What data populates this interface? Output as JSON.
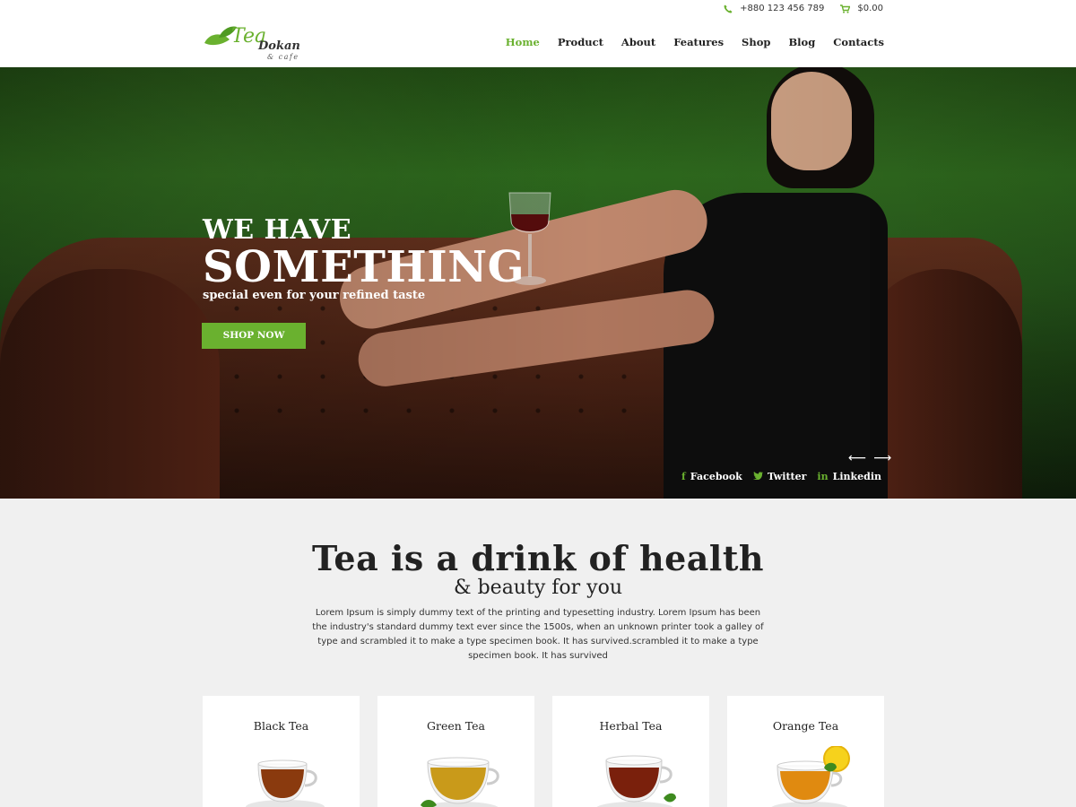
{
  "topbar": {
    "phone": "+880 123 456 789",
    "cart": "$0.00"
  },
  "logo": {
    "script": "Tea",
    "name": "Dokan",
    "sub": "& cafe"
  },
  "nav": {
    "items": [
      "Home",
      "Product",
      "About",
      "Features",
      "Shop",
      "Blog",
      "Contacts"
    ],
    "active": "Home"
  },
  "hero": {
    "line1": "WE HAVE",
    "line2": "SOMETHING",
    "line3": "special even for your refined taste",
    "button": "SHOP NOW",
    "social": [
      "Facebook",
      "Twitter",
      "Linkedin"
    ]
  },
  "intro": {
    "title": "Tea is a drink of health",
    "subtitle": "& beauty for you",
    "body": "Lorem Ipsum is simply dummy text of the printing and typesetting industry. Lorem Ipsum has been the industry's standard dummy text ever since the 1500s, when an unknown printer took a galley of type and scrambled it to make a type specimen book. It has survived.scrambled it to make a type specimen book. It has survived"
  },
  "cards": [
    {
      "title": "Black Tea",
      "color": "#8a3a0e"
    },
    {
      "title": "Green Tea",
      "color": "#c99a1a"
    },
    {
      "title": "Herbal Tea",
      "color": "#7a200c"
    },
    {
      "title": "Orange Tea",
      "color": "#e08a10"
    }
  ],
  "colors": {
    "accent": "#6ab12f"
  }
}
